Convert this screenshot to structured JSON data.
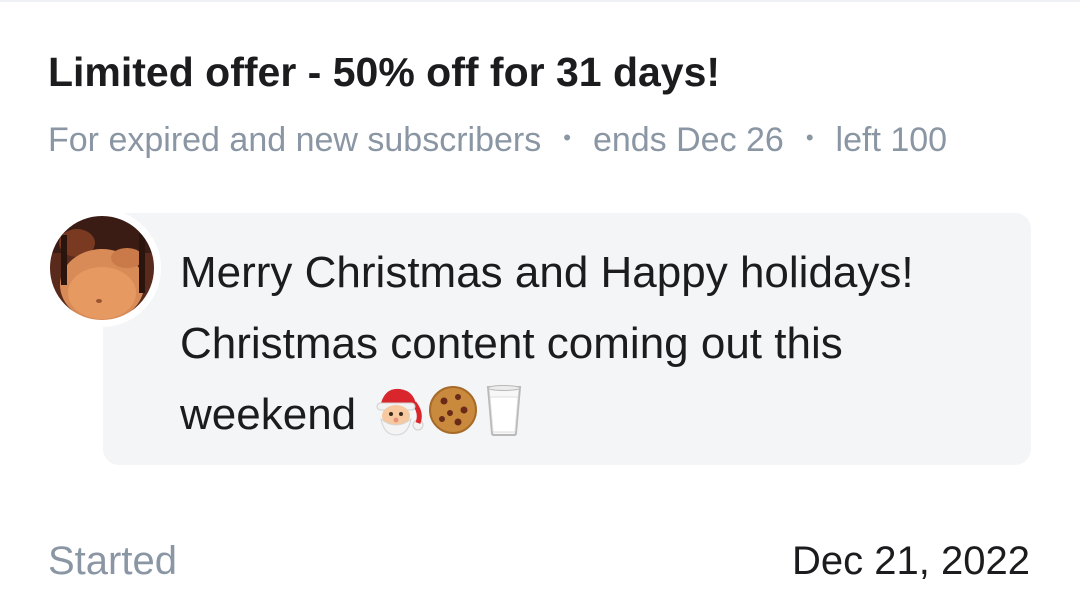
{
  "offer": {
    "title": "Limited offer - 50% off for 31 days!",
    "audience": "For expired and new subscribers",
    "ends": "ends Dec 26",
    "left": "left 100",
    "separator": "•"
  },
  "message": {
    "line1": "Merry Christmas and Happy holidays!",
    "line2": "Christmas content coming out this",
    "line3": "weekend",
    "emojis": [
      "santa-icon",
      "cookie-icon",
      "milk-glass-icon"
    ]
  },
  "footer": {
    "label": "Started",
    "value": "Dec 21, 2022"
  },
  "colors": {
    "title": "#1c1c1e",
    "muted": "#8a96a3",
    "bubble": "#f4f5f7"
  }
}
